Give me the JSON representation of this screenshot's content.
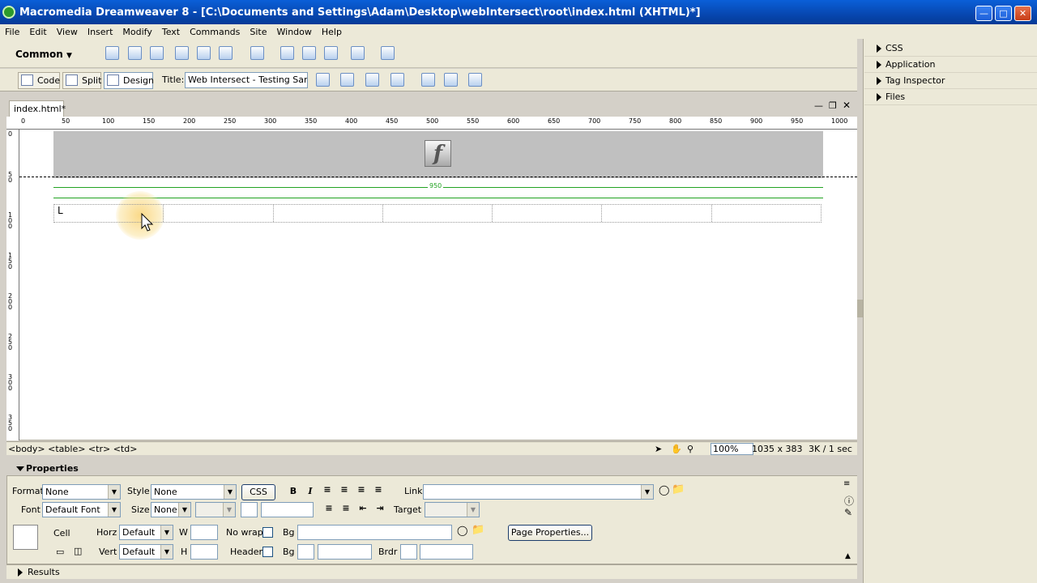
{
  "window": {
    "title": "Macromedia Dreamweaver 8 - [C:\\Documents and Settings\\Adam\\Desktop\\webIntersect\\root\\index.html (XHTML)*]"
  },
  "menu": [
    "File",
    "Edit",
    "View",
    "Insert",
    "Modify",
    "Text",
    "Commands",
    "Site",
    "Window",
    "Help"
  ],
  "insert_bar": {
    "category": "Common"
  },
  "doc_toolbar": {
    "code": "Code",
    "split": "Split",
    "design": "Design",
    "title_label": "Title:",
    "title_value": "Web Intersect - Testing Sandt"
  },
  "document": {
    "tab": "index.html*",
    "ruler_top": [
      "0",
      "50",
      "100",
      "150",
      "200",
      "250",
      "300",
      "350",
      "400",
      "450",
      "500",
      "550",
      "600",
      "650",
      "700",
      "750",
      "800",
      "850",
      "900",
      "950",
      "1000"
    ],
    "ruler_left": [
      "0",
      "5\n0",
      "1\n0\n0",
      "1\n5\n0",
      "2\n0\n0",
      "2\n5\n0",
      "3\n0\n0",
      "3\n5\n0"
    ],
    "table_width": "950",
    "cell_text": "L"
  },
  "status": {
    "tags": "<body> <table> <tr> <td>",
    "zoom": "100%",
    "dimensions": "1035 x 383",
    "download": "3K / 1 sec"
  },
  "properties": {
    "header": "Properties",
    "format_label": "Format",
    "format_value": "None",
    "style_label": "Style",
    "style_value": "None",
    "css_button": "CSS",
    "link_label": "Link",
    "font_label": "Font",
    "font_value": "Default Font",
    "size_label": "Size",
    "size_value": "None",
    "target_label": "Target",
    "cell_label": "Cell",
    "horz_label": "Horz",
    "horz_value": "Default",
    "vert_label": "Vert",
    "vert_value": "Default",
    "w_label": "W",
    "h_label": "H",
    "nowrap_label": "No wrap",
    "header_label": "Header",
    "bg_label": "Bg",
    "brdr_label": "Brdr",
    "page_props_button": "Page Properties..."
  },
  "results": {
    "label": "Results"
  },
  "panels": [
    "CSS",
    "Application",
    "Tag Inspector",
    "Files"
  ]
}
